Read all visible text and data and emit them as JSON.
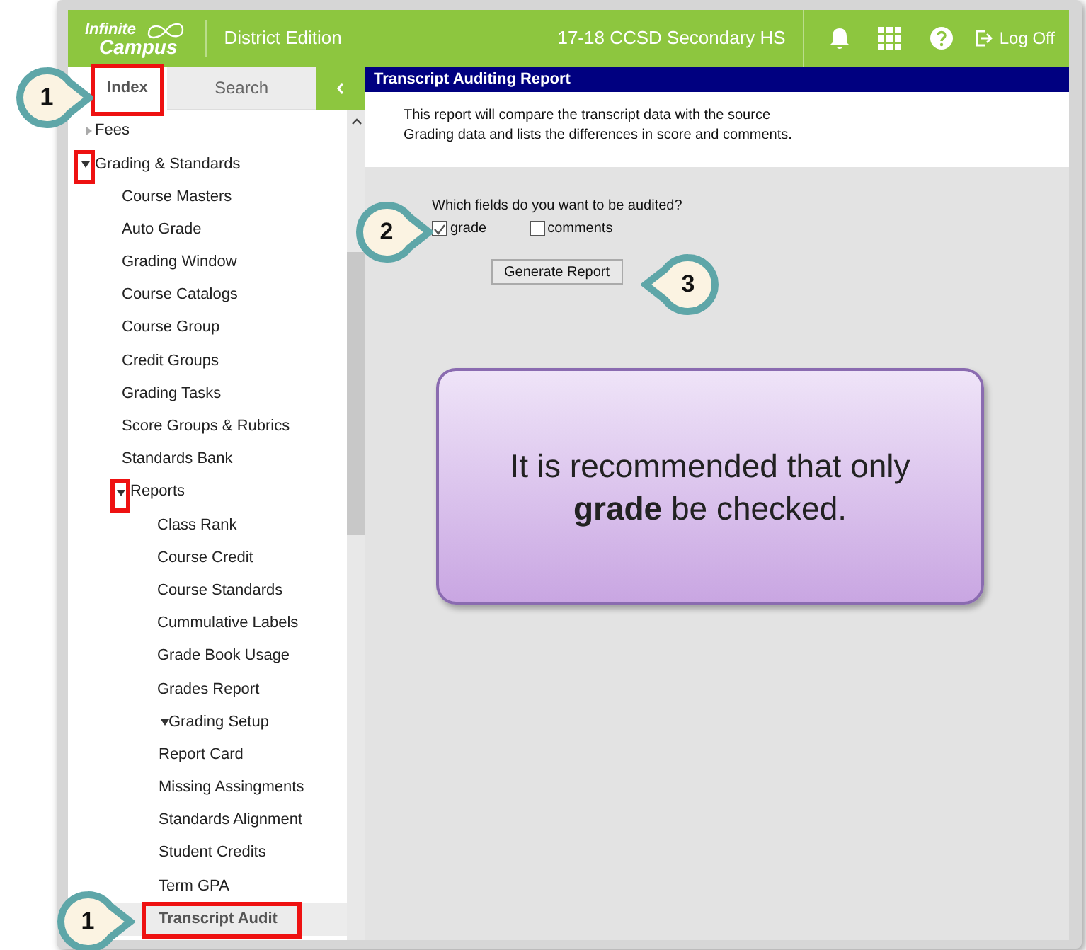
{
  "header": {
    "logo_top": "Infinite",
    "logo_bottom": "Campus",
    "edition": "District Edition",
    "school": "17-18 CCSD Secondary HS",
    "logoff": "Log Off"
  },
  "sidebar": {
    "tabs": [
      {
        "label": "Index",
        "selected": true
      },
      {
        "label": "Search",
        "selected": false
      }
    ],
    "tree": [
      {
        "label": "Fees",
        "expanded": false,
        "selected": false
      },
      {
        "label": "Grading & Standards",
        "expanded": true,
        "selected": false,
        "children": [
          {
            "label": "Course Masters",
            "selected": false
          },
          {
            "label": "Auto Grade",
            "selected": false
          },
          {
            "label": "Grading Window",
            "selected": false
          },
          {
            "label": "Course Catalogs",
            "selected": false
          },
          {
            "label": "Course Group",
            "selected": false
          },
          {
            "label": "Credit Groups",
            "selected": false
          },
          {
            "label": "Grading Tasks",
            "selected": false
          },
          {
            "label": "Score Groups & Rubrics",
            "selected": false
          },
          {
            "label": "Standards Bank",
            "selected": false
          },
          {
            "label": "Reports",
            "expanded": true,
            "selected": false,
            "children": [
              {
                "label": "Class Rank",
                "selected": false
              },
              {
                "label": "Course Credit",
                "selected": false
              },
              {
                "label": "Course Standards",
                "selected": false
              },
              {
                "label": "Cummulative Labels",
                "selected": false
              },
              {
                "label": "Grade Book Usage",
                "selected": false
              },
              {
                "label": "Grades Report",
                "selected": false
              },
              {
                "label": "Grading Setup",
                "expanded": true,
                "selected": false,
                "children": [
                  {
                    "label": "Report Card",
                    "selected": false
                  },
                  {
                    "label": "Missing Assingments",
                    "selected": false
                  },
                  {
                    "label": "Standards Alignment",
                    "selected": false
                  },
                  {
                    "label": "Student Credits",
                    "selected": false
                  },
                  {
                    "label": "Term GPA",
                    "selected": false
                  },
                  {
                    "label": "Transcript Audit",
                    "selected": true
                  }
                ]
              }
            ]
          }
        ]
      }
    ]
  },
  "report": {
    "title": "Transcript Auditing Report",
    "description_lines": [
      "This report will compare the transcript data with the source",
      "Grading data and lists the differences in score and comments."
    ],
    "question": "Which fields do you want to be audited?",
    "fields": [
      {
        "label": "grade",
        "checked": true
      },
      {
        "label": "comments",
        "checked": false
      }
    ],
    "button": "Generate Report"
  },
  "callouts": [
    {
      "number": "1"
    },
    {
      "number": "2"
    },
    {
      "number": "3"
    },
    {
      "number": "1"
    }
  ],
  "note": "It is recommended that only **grade** be checked."
}
